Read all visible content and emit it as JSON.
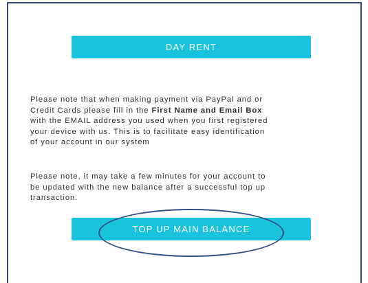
{
  "buttons": {
    "day_rent": "DAY RENT",
    "top_up": "TOP UP MAIN BALANCE"
  },
  "notice1": {
    "line1": "Please note that when making payment via PayPal and or",
    "line2_pre": "Credit Cards please fill in the ",
    "line2_bold": "First Name and Email Box",
    "line3": "with the EMAIL address you used when you first registered",
    "line4": "your device with us. This is to facilitate easy identification",
    "line5": "of your account in our system"
  },
  "notice2": {
    "line1": "Please note, it may take a few minutes for your account to",
    "line2": "be updated with the new balance after a successful top up",
    "line3": "transaction."
  },
  "colors": {
    "button": "#19c3dd",
    "frame": "#2b4a7a",
    "annotation": "#2f4f86"
  }
}
